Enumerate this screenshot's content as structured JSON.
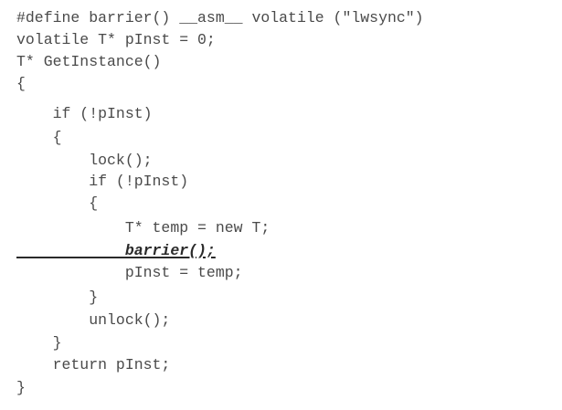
{
  "code": {
    "lines": [
      "#define barrier() __asm__ volatile (\"lwsync\")",
      "volatile T* pInst = 0;",
      "T* GetInstance()",
      "{",
      "    if (!pInst)",
      "    {",
      "        lock();",
      "        if (!pInst)",
      "        {",
      "            T* temp = new T;",
      "            barrier();",
      "            pInst = temp;",
      "        }",
      "        unlock();",
      "    }",
      "    return pInst;",
      "}"
    ],
    "emphasized_line_index": 10
  }
}
